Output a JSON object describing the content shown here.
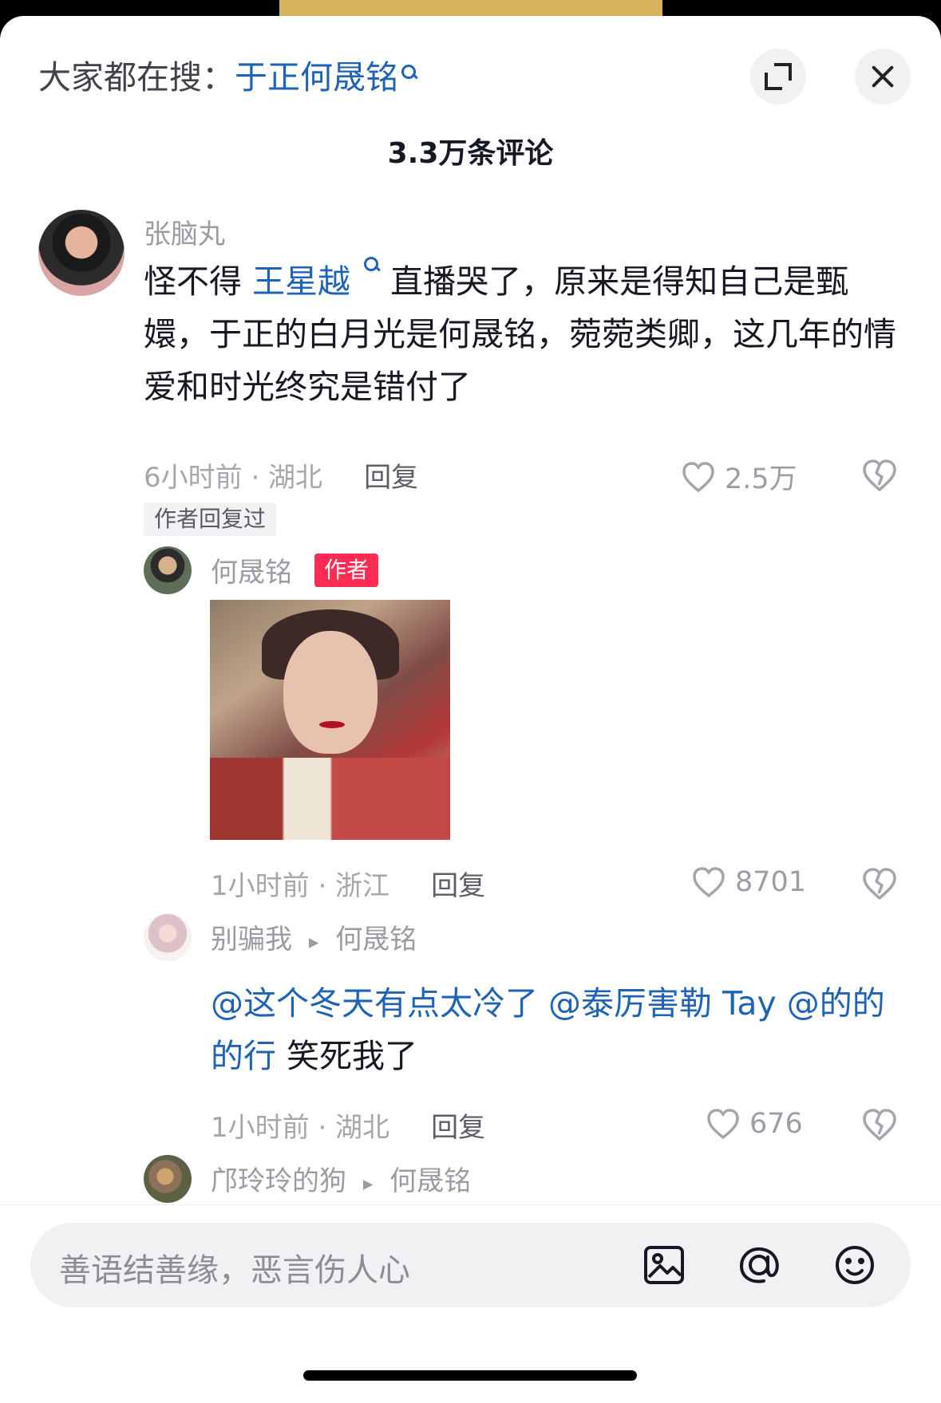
{
  "search": {
    "prefix": "大家都在搜：",
    "term": "于正何晟铭",
    "icons": [
      "search-icon",
      "expand-icon",
      "close-icon"
    ]
  },
  "comments_title": "3.3万条评论",
  "comment_main": {
    "user": "张脑丸",
    "text_before": "怪不得",
    "topic": "王星越",
    "text_after": "直播哭了，原来是得知自己是甄嬛，于正的白月光是何晟铭，菀菀类卿，这几年的情爱和时光终究是错付了",
    "meta": "6小时前 · 湖北",
    "reply_label": "回复",
    "likes": "2.5万",
    "author_replied": "作者回复过"
  },
  "author_reply": {
    "user": "何晟铭",
    "badge": "作者",
    "meta": "1小时前 · 浙江",
    "reply_label": "回复",
    "likes": "8701"
  },
  "reply_1": {
    "user": "别骗我",
    "arrow": "▸",
    "target": "何晟铭",
    "text_link": "@这个冬天有点太冷了 @泰厉害勒 Tay @的的的行",
    "text_tail": " 笑死我了",
    "meta": "1小时前 · 湖北",
    "reply_label": "回复",
    "likes": "676"
  },
  "reply_2": {
    "user": "邝玲玲的狗",
    "arrow": "▸",
    "target": "何晟铭"
  },
  "input": {
    "placeholder": "善语结善缘，恶言伤人心",
    "icons": [
      "image-icon",
      "at-icon",
      "emoji-icon"
    ]
  },
  "colors": {
    "accent_blue": "#1f63b5",
    "author_badge": "#fe2c55",
    "background": "#ffffff"
  }
}
